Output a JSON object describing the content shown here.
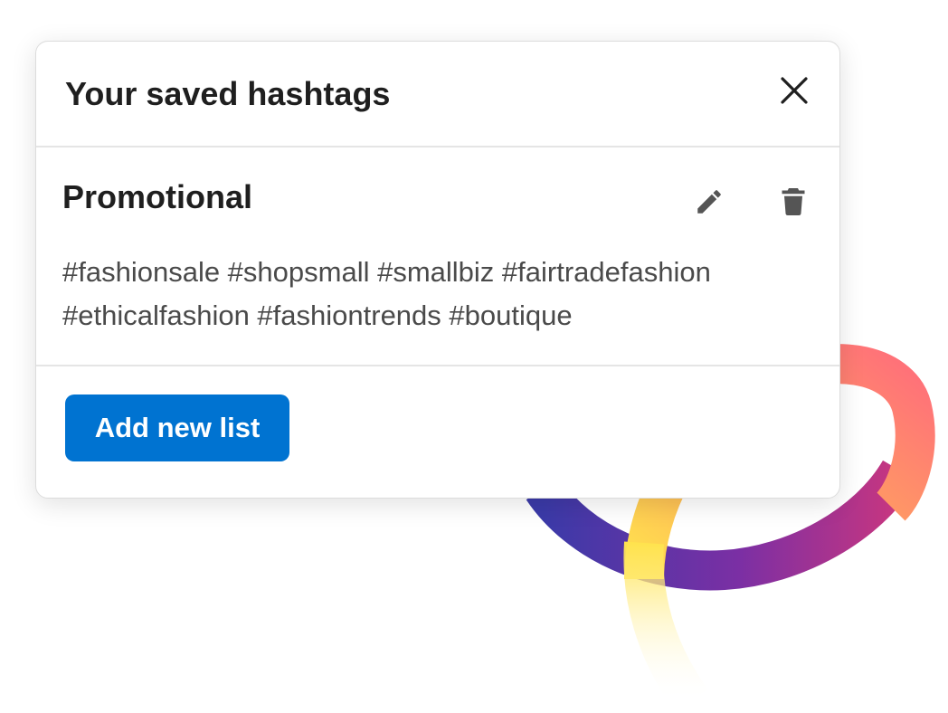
{
  "panel": {
    "title": "Your saved hashtags",
    "close_icon": "close-icon"
  },
  "list": {
    "name": "Promotional",
    "edit_icon": "pencil-icon",
    "delete_icon": "trash-icon",
    "hashtags": "#fashionsale #shopsmall #smallbiz #fairtradefashion #ethicalfashion #fashiontrends #boutique"
  },
  "actions": {
    "add_label": "Add new list"
  },
  "colors": {
    "primary_button": "#0073d1",
    "icon_gray": "#555555",
    "text_dark": "#1f1f1f",
    "text_muted": "#4a4a4a"
  }
}
